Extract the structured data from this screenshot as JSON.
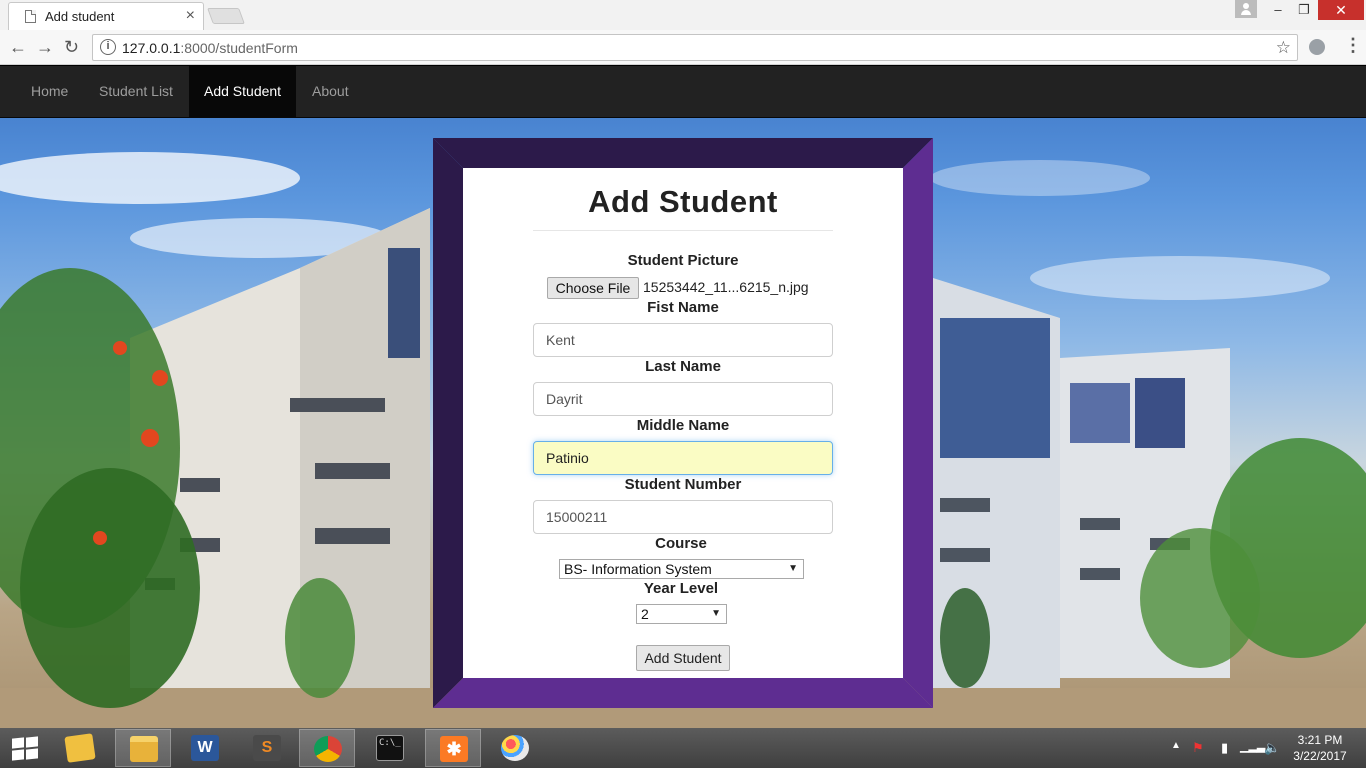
{
  "browser": {
    "tab_title": "Add student",
    "url_host": "127.0.0.1",
    "url_path": ":8000/studentForm"
  },
  "navbar": {
    "items": [
      {
        "label": "Home",
        "active": false
      },
      {
        "label": "Student List",
        "active": false
      },
      {
        "label": "Add Student",
        "active": true
      },
      {
        "label": "About",
        "active": false
      }
    ]
  },
  "form": {
    "title": "Add Student",
    "picture_label": "Student Picture",
    "choose_file_label": "Choose File",
    "file_name": "15253442_11...6215_n.jpg",
    "first_name_label": "Fist Name",
    "first_name_value": "Kent",
    "last_name_label": "Last Name",
    "last_name_value": "Dayrit",
    "middle_name_label": "Middle Name",
    "middle_name_value": "Patinio",
    "student_number_label": "Student Number",
    "student_number_value": "15000211",
    "course_label": "Course",
    "course_value": "BS- Information System",
    "year_level_label": "Year Level",
    "year_level_value": "2",
    "submit_label": "Add Student"
  },
  "taskbar": {
    "apps": [
      "file-explorer",
      "file-manager",
      "word",
      "sublime-text",
      "chrome",
      "command-prompt",
      "xampp",
      "paint"
    ],
    "clock_time": "3:21 PM",
    "clock_date": "3/22/2017"
  },
  "colors": {
    "navbar_bg": "#222222",
    "frame_dark": "#2c1a4a",
    "frame_light": "#5e2d91"
  }
}
